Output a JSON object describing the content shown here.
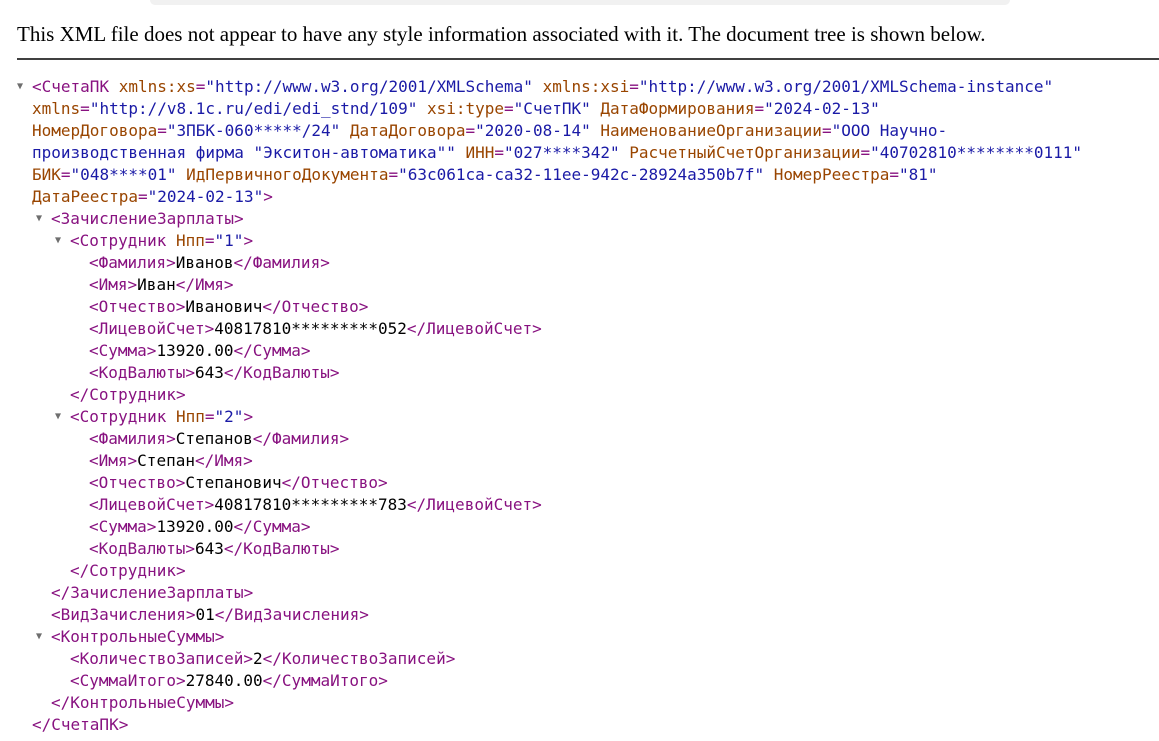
{
  "header": {
    "notice": "This XML file does not appear to have any style information associated with it. The document tree is shown below."
  },
  "root": {
    "open_tag": "СчетаПК",
    "attr1_name": "xmlns:xs",
    "attr1_value": "\"http://www.w3.org/2001/XMLSchema\"",
    "attr2_name": "xmlns:xsi",
    "attr2_value": "\"http://www.w3.org/2001/XMLSchema-instance\"",
    "attr3_name": "xmlns",
    "attr3_value": "\"http://v8.1c.ru/edi/edi_stnd/109\"",
    "attr4_name": "xsi:type",
    "attr4_value": "\"СчетПК\"",
    "attr5_name": "ДатаФормирования",
    "attr5_value": "\"2024-02-13\"",
    "attr6_name": "НомерДоговора",
    "attr6_value": "\"ЗПБК-060*****/24\"",
    "attr7_name": "ДатаДоговора",
    "attr7_value": "\"2020-08-14\"",
    "attr8_name": "НаименованиеОрганизации",
    "attr8_value_part1": "\"ООО Научно-",
    "attr8_value_part2": "производственная фирма \"Экситон-автоматика\"\"",
    "attr9_name": "ИНН",
    "attr9_value": "\"027****342\"",
    "attr10_name": "РасчетныйСчетОрганизации",
    "attr10_value": "\"40702810********0111\"",
    "attr11_name": "БИК",
    "attr11_value": "\"048****01\"",
    "attr12_name": "ИдПервичногоДокумента",
    "attr12_value": "\"63c061ca-ca32-11ee-942c-28924a350b7f\"",
    "attr13_name": "НомерРеестра",
    "attr13_value": "\"81\"",
    "attr14_name": "ДатаРеестра",
    "attr14_value": "\"2024-02-13\"",
    "close_tag": "</СчетаПК>"
  },
  "payroll": {
    "open_tag": "<ЗачислениеЗарплаты>",
    "close_tag": "</ЗачислениеЗарплаты>",
    "employee_tag": "Сотрудник",
    "employee_attr_name": "Нпп",
    "employee_close": "</Сотрудник>",
    "employees": [
      {
        "npp": "\"1\"",
        "lastname": "Иванов",
        "firstname": "Иван",
        "middlename": "Иванович",
        "account": "40817810*********052",
        "amount": "13920.00",
        "currency": "643"
      },
      {
        "npp": "\"2\"",
        "lastname": "Степанов",
        "firstname": "Степан",
        "middlename": "Степанович",
        "account": "40817810*********783",
        "amount": "13920.00",
        "currency": "643"
      }
    ]
  },
  "fields": {
    "lastname_open": "<Фамилия>",
    "lastname_close": "</Фамилия>",
    "firstname_open": "<Имя>",
    "firstname_close": "</Имя>",
    "middlename_open": "<Отчество>",
    "middlename_close": "</Отчество>",
    "account_open": "<ЛицевойСчет>",
    "account_close": "</ЛицевойСчет>",
    "amount_open": "<Сумма>",
    "amount_close": "</Сумма>",
    "currency_open": "<КодВалюты>",
    "currency_close": "</КодВалюты>"
  },
  "credit_type": {
    "open_tag": "<ВидЗачисления>",
    "value": "01",
    "close_tag": "</ВидЗачисления>"
  },
  "control": {
    "open_tag": "<КонтрольныеСуммы>",
    "count_open": "<КоличествоЗаписей>",
    "count_value": "2",
    "count_close": "</КоличествоЗаписей>",
    "total_open": "<СуммаИтого>",
    "total_value": "27840.00",
    "total_close": "</СуммаИтого>",
    "close_tag": "</КонтрольныеСуммы>"
  },
  "icons": {
    "toggle": "▼"
  },
  "colors": {
    "tag": "#881280",
    "attr_name": "#994500",
    "attr_value": "#1a1aa6",
    "text": "#000000"
  }
}
